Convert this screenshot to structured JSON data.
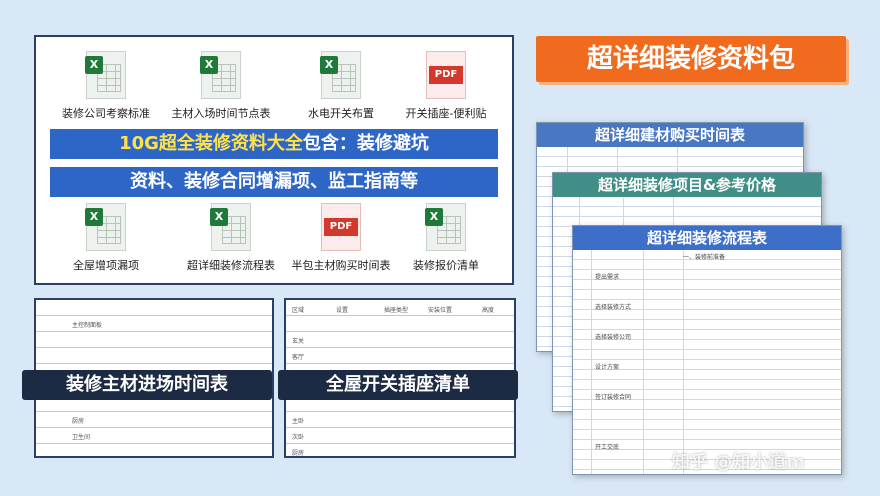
{
  "files_panel": {
    "files": [
      {
        "label": "装修公司考察标准",
        "icon": "excel-icon"
      },
      {
        "label": "主材入场时间节点表",
        "icon": "excel-icon"
      },
      {
        "label": "水电开关布置",
        "icon": "excel-icon"
      },
      {
        "label": "开关插座-便利贴",
        "icon": "pdf-icon"
      },
      {
        "label": "全屋增项漏项",
        "icon": "excel-icon"
      },
      {
        "label": "超详细装修流程表",
        "icon": "excel-icon"
      },
      {
        "label": "半包主材购买时间表",
        "icon": "pdf-icon"
      },
      {
        "label": "装修报价清单",
        "icon": "excel-icon"
      }
    ],
    "headline_1_highlight": "10G超全装修资料大全",
    "headline_1_rest": "包含：装修避坑",
    "headline_2": "资料、装修合同增漏项、监工指南等",
    "excel_badge": "X",
    "pdf_badge": "PDF"
  },
  "brand_title": "超详细装修资料包",
  "sheets": [
    {
      "title": "超详细建材购买时间表"
    },
    {
      "title": "超详细装修项目&参考价格"
    },
    {
      "title": "超详细装修流程表"
    }
  ],
  "sheet3_rows": [
    "一、装修前准备",
    "提出需求",
    "选择装修方式",
    "选择装修公司",
    "设计方案",
    "签订装修合同",
    "开工交底"
  ],
  "table_left": {
    "ribbon": "装修主材进场时间表",
    "cells": [
      "主控制面板",
      "厨房",
      "卫生间"
    ]
  },
  "table_right": {
    "headers": [
      "区域",
      "设置",
      "插座类型",
      "安装位置",
      "高度"
    ],
    "ribbon": "全屋开关插座清单",
    "cells": [
      "玄关",
      "客厅",
      "主卧",
      "次卧",
      "厨房"
    ]
  },
  "watermark": "知乎 @知小道m",
  "colors": {
    "accent_orange": "#f16b1e",
    "headline_blue": "#2e66c7",
    "highlight_yellow": "#ffe24a",
    "ribbon_dark": "#1d2a44"
  }
}
